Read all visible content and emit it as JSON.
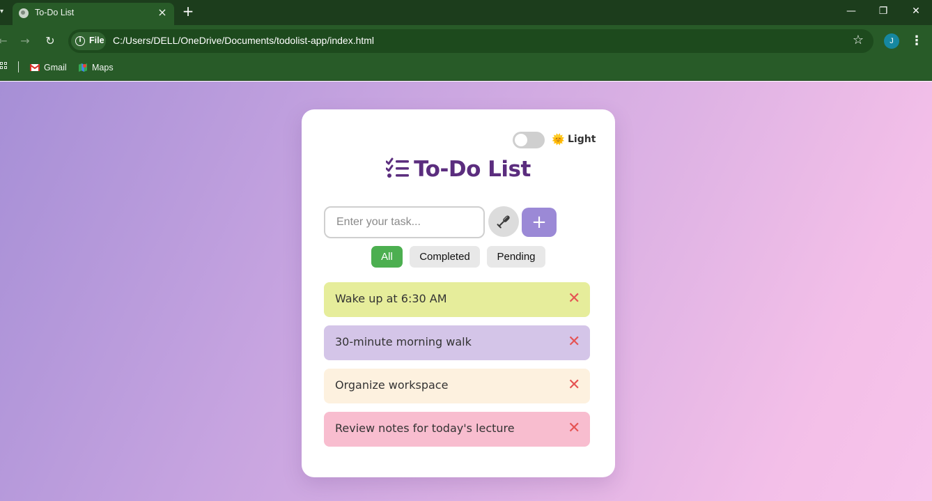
{
  "browser": {
    "tab": {
      "title": "To-Do List"
    },
    "window_controls": {
      "minimize": "—",
      "restore": "❐",
      "close": "✕"
    },
    "address_bar": {
      "scheme_label": "File",
      "url": "C:/Users/DELL/OneDrive/Documents/todolist-app/index.html"
    },
    "profile_initial": "J",
    "bookmarks": [
      {
        "label": "Gmail",
        "icon": "gmail-icon"
      },
      {
        "label": "Maps",
        "icon": "maps-icon"
      }
    ]
  },
  "app": {
    "theme": {
      "label": "Light",
      "icon": "sun-icon",
      "dark_mode": false
    },
    "title": "To-Do List",
    "input": {
      "placeholder": "Enter your task...",
      "value": ""
    },
    "add_button_label": "+",
    "filters": [
      {
        "label": "All",
        "active": true
      },
      {
        "label": "Completed",
        "active": false
      },
      {
        "label": "Pending",
        "active": false
      }
    ],
    "tasks": [
      {
        "text": "Wake up at 6:30 AM",
        "color": "#e6ed9b"
      },
      {
        "text": "30-minute morning walk",
        "color": "#d4c5e8"
      },
      {
        "text": "Organize workspace",
        "color": "#fdf1df"
      },
      {
        "text": "Review notes for today's lecture",
        "color": "#f8bdcf"
      }
    ],
    "delete_glyph": "✕",
    "colors": {
      "accent": "#9b89d6",
      "title": "#5b2d7e",
      "active_filter": "#4caf50",
      "delete": "#e55353"
    }
  }
}
